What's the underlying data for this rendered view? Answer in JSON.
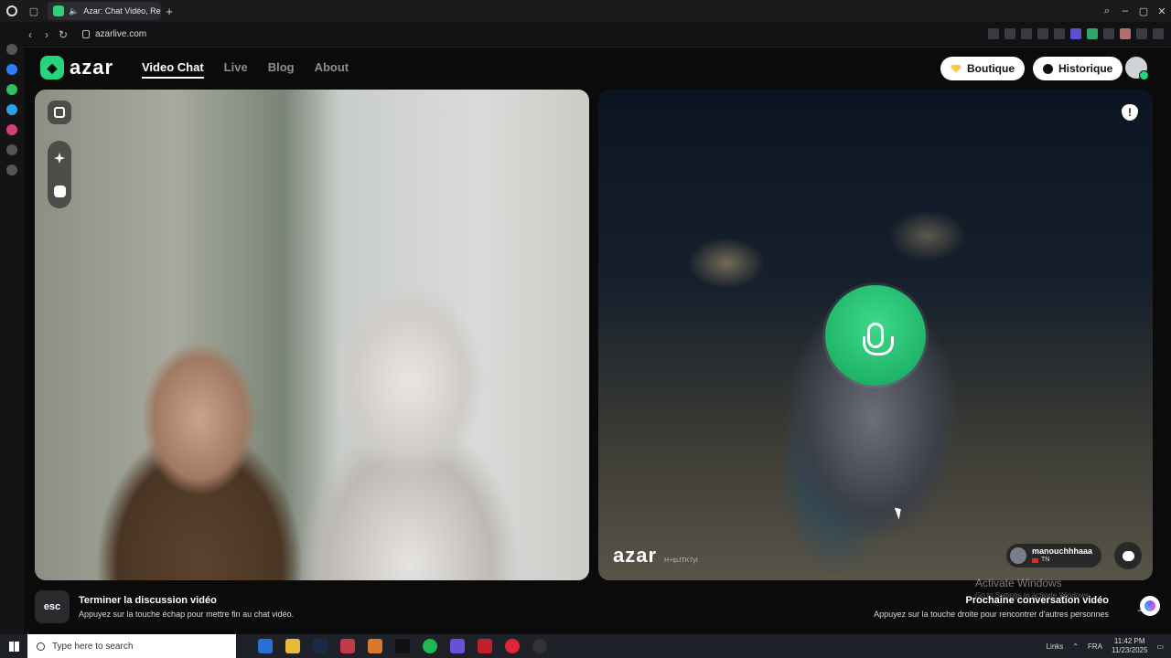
{
  "browser": {
    "tab_title": "Azar: Chat Vidéo, Ren",
    "url": "azarlive.com"
  },
  "site": {
    "logo_text": "azar",
    "nav": [
      {
        "label": "Video Chat",
        "active": true
      },
      {
        "label": "Live",
        "active": false
      },
      {
        "label": "Blog",
        "active": false
      },
      {
        "label": "About",
        "active": false
      }
    ],
    "boutique_label": "Boutique",
    "historique_label": "Historique"
  },
  "remote": {
    "watermark": "azar",
    "session_id": "H+tpJTK7yI",
    "username": "manouchhhaaa",
    "country": "TN"
  },
  "bottom": {
    "esc_key": "esc",
    "end_title": "Terminer la discussion vidéo",
    "end_sub": "Appuyez sur la touche échap pour mettre fin au chat vidéo.",
    "next_title": "Prochaine conversation vidéo",
    "next_sub": "Appuyez sur la touche droite pour rencontrer d'autres personnes"
  },
  "os": {
    "activate_title": "Activate Windows",
    "activate_sub": "Go to Settings to activate Windows.",
    "search_placeholder": "Type here to search",
    "tray_links": "Links",
    "tray_lang": "FRA",
    "time": "11:42 PM",
    "date": "11/23/2025"
  },
  "colors": {
    "accent": "#27d47d",
    "background": "#0b0b0c"
  }
}
